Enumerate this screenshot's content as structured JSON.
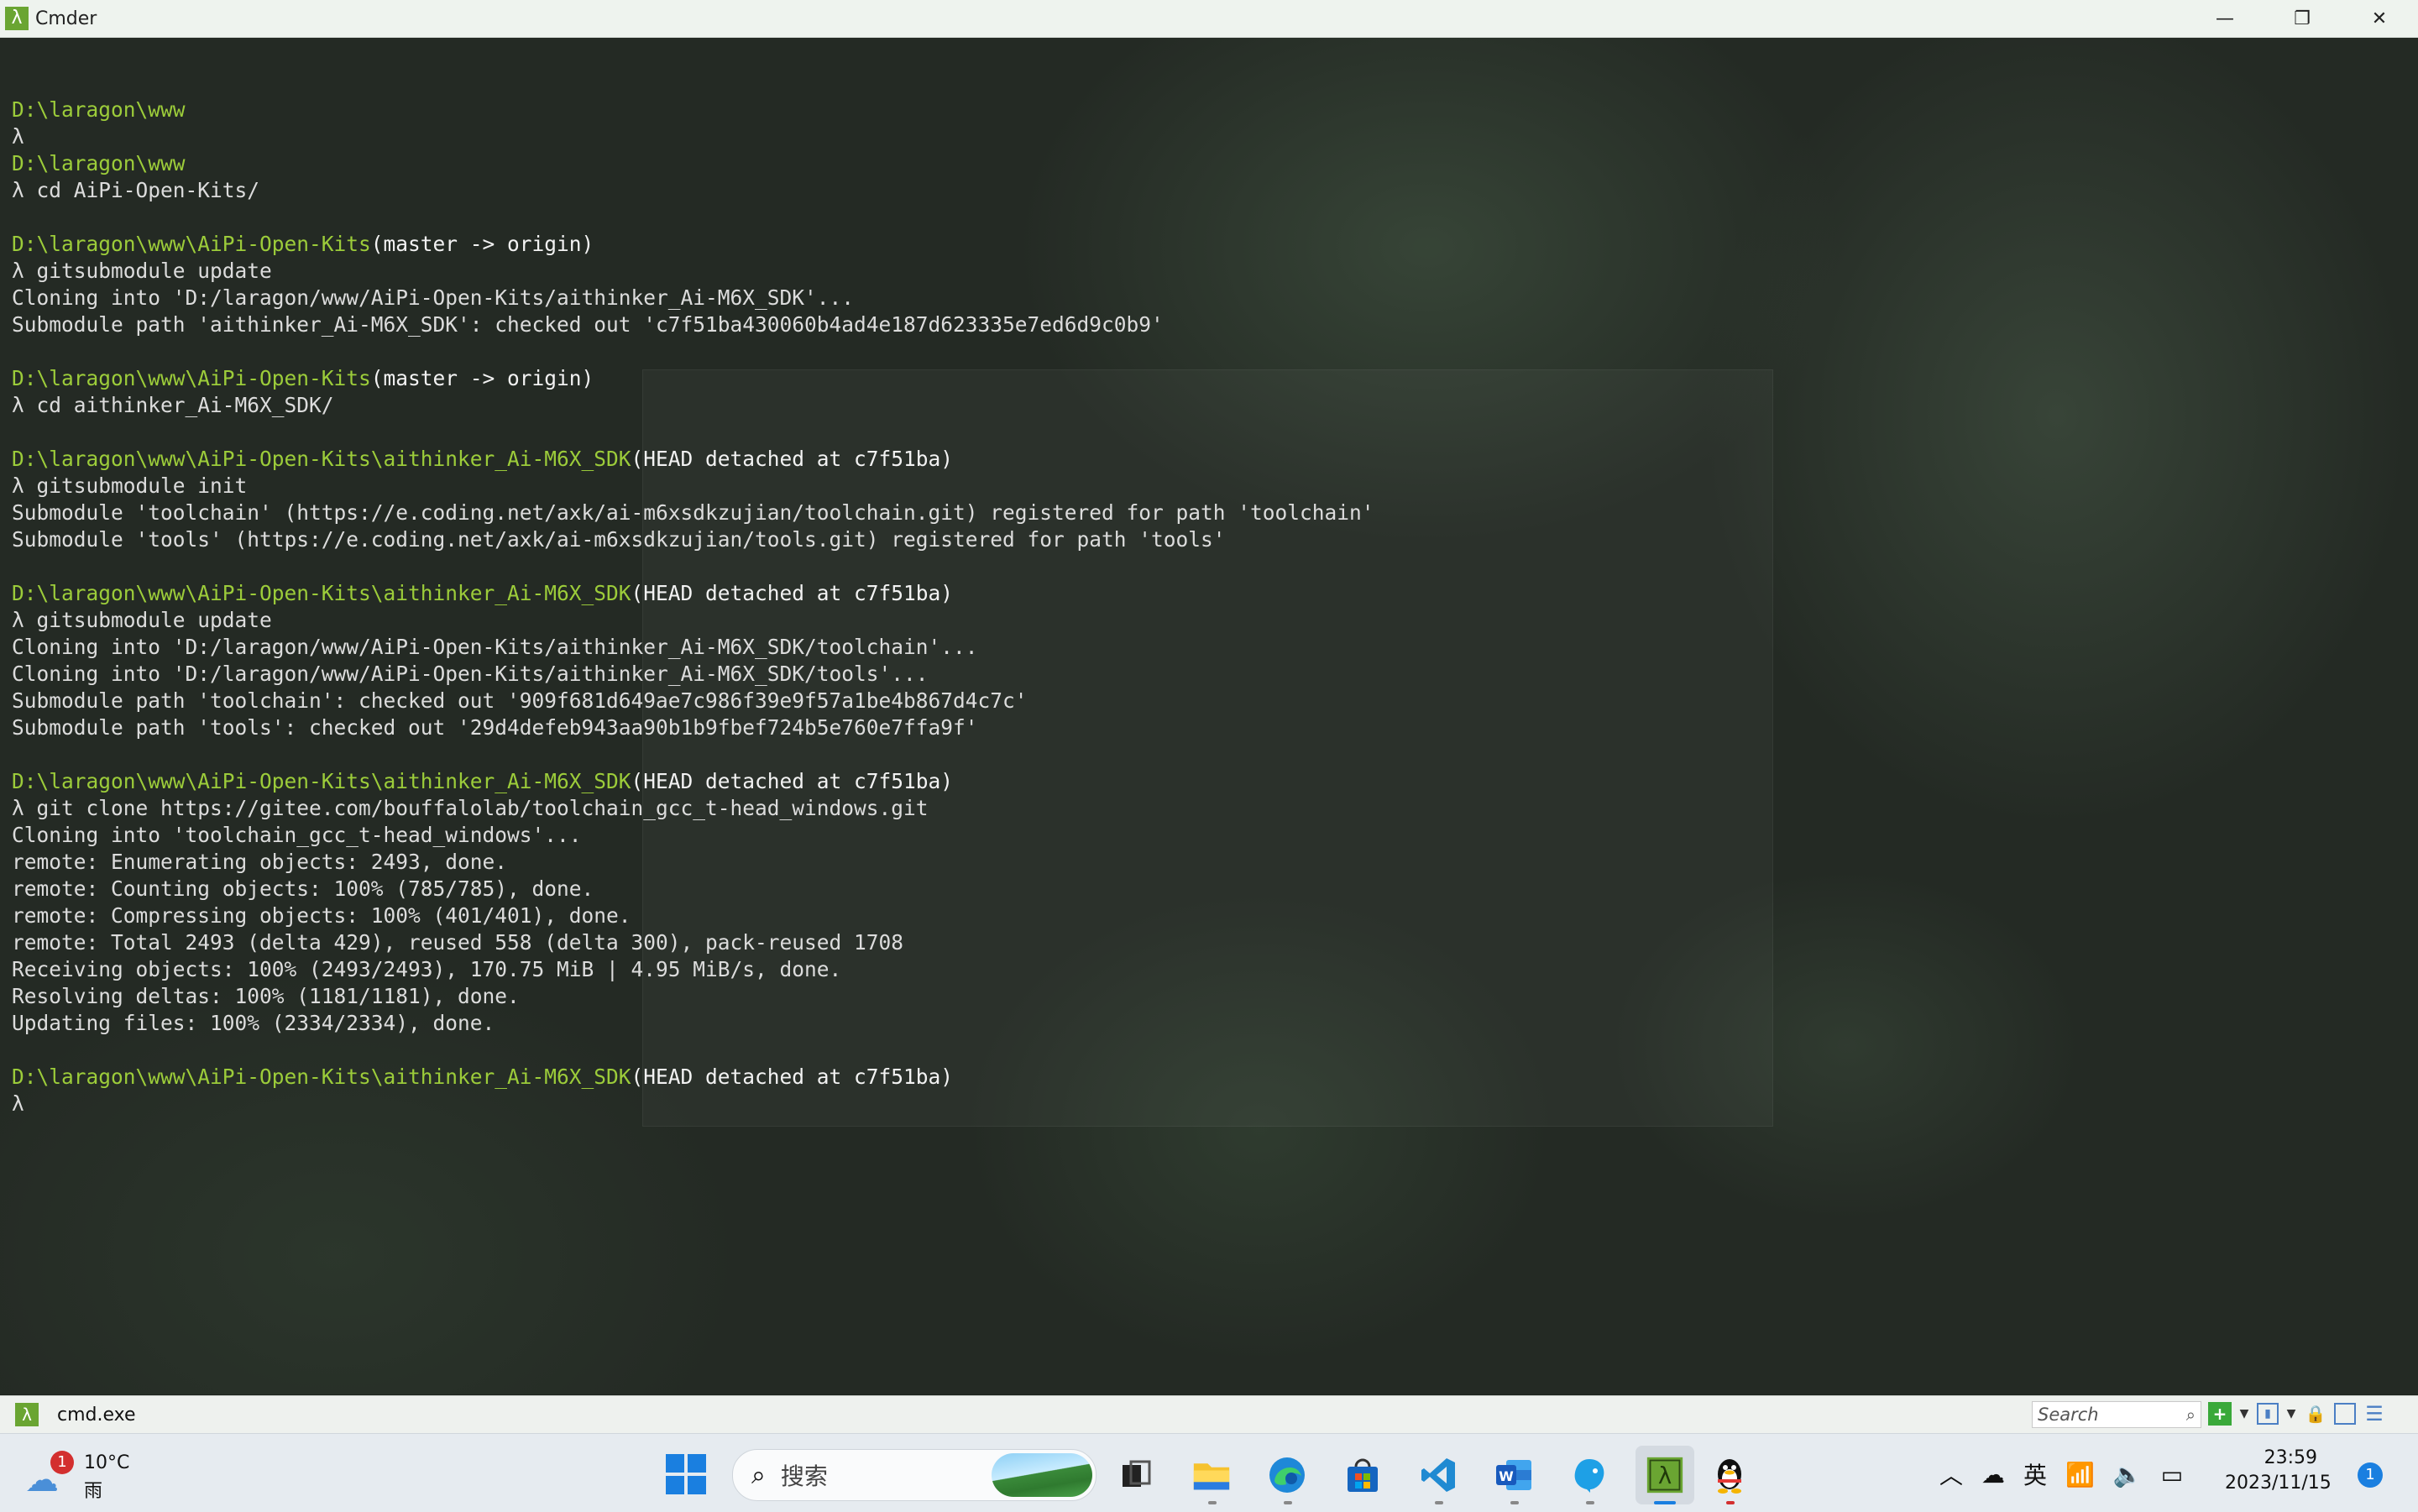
{
  "window": {
    "title": "Cmder",
    "app_icon_glyph": "λ",
    "controls": {
      "minimize": "—",
      "restore": "❐",
      "close": "✕"
    }
  },
  "console": {
    "lines": [
      {
        "kind": "blank"
      },
      {
        "kind": "prompt",
        "path": "D:\\laragon\\www",
        "branch": ""
      },
      {
        "kind": "cmd",
        "text": "λ"
      },
      {
        "kind": "prompt",
        "path": "D:\\laragon\\www",
        "branch": ""
      },
      {
        "kind": "cmd",
        "text": "λ cd AiPi-Open-Kits/"
      },
      {
        "kind": "blank"
      },
      {
        "kind": "prompt",
        "path": "D:\\laragon\\www\\AiPi-Open-Kits",
        "branch": "(master -> origin)"
      },
      {
        "kind": "cmd",
        "text": "λ gitsubmodule update"
      },
      {
        "kind": "out",
        "text": "Cloning into 'D:/laragon/www/AiPi-Open-Kits/aithinker_Ai-M6X_SDK'..."
      },
      {
        "kind": "out",
        "text": "Submodule path 'aithinker_Ai-M6X_SDK': checked out 'c7f51ba430060b4ad4e187d623335e7ed6d9c0b9'"
      },
      {
        "kind": "blank"
      },
      {
        "kind": "prompt",
        "path": "D:\\laragon\\www\\AiPi-Open-Kits",
        "branch": "(master -> origin)"
      },
      {
        "kind": "cmd",
        "text": "λ cd aithinker_Ai-M6X_SDK/"
      },
      {
        "kind": "blank"
      },
      {
        "kind": "prompt",
        "path": "D:\\laragon\\www\\AiPi-Open-Kits\\aithinker_Ai-M6X_SDK",
        "branch": "(HEAD detached at c7f51ba)"
      },
      {
        "kind": "cmd",
        "text": "λ gitsubmodule init"
      },
      {
        "kind": "out",
        "text": "Submodule 'toolchain' (https://e.coding.net/axk/ai-m6xsdkzujian/toolchain.git) registered for path 'toolchain'"
      },
      {
        "kind": "out",
        "text": "Submodule 'tools' (https://e.coding.net/axk/ai-m6xsdkzujian/tools.git) registered for path 'tools'"
      },
      {
        "kind": "blank"
      },
      {
        "kind": "prompt",
        "path": "D:\\laragon\\www\\AiPi-Open-Kits\\aithinker_Ai-M6X_SDK",
        "branch": "(HEAD detached at c7f51ba)"
      },
      {
        "kind": "cmd",
        "text": "λ gitsubmodule update"
      },
      {
        "kind": "out",
        "text": "Cloning into 'D:/laragon/www/AiPi-Open-Kits/aithinker_Ai-M6X_SDK/toolchain'..."
      },
      {
        "kind": "out",
        "text": "Cloning into 'D:/laragon/www/AiPi-Open-Kits/aithinker_Ai-M6X_SDK/tools'..."
      },
      {
        "kind": "out",
        "text": "Submodule path 'toolchain': checked out '909f681d649ae7c986f39e9f57a1be4b867d4c7c'"
      },
      {
        "kind": "out",
        "text": "Submodule path 'tools': checked out '29d4defeb943aa90b1b9fbef724b5e760e7ffa9f'"
      },
      {
        "kind": "blank"
      },
      {
        "kind": "prompt",
        "path": "D:\\laragon\\www\\AiPi-Open-Kits\\aithinker_Ai-M6X_SDK",
        "branch": "(HEAD detached at c7f51ba)"
      },
      {
        "kind": "cmd",
        "text": "λ git clone https://gitee.com/bouffalolab/toolchain_gcc_t-head_windows.git"
      },
      {
        "kind": "out",
        "text": "Cloning into 'toolchain_gcc_t-head_windows'..."
      },
      {
        "kind": "out",
        "text": "remote: Enumerating objects: 2493, done."
      },
      {
        "kind": "out",
        "text": "remote: Counting objects: 100% (785/785), done."
      },
      {
        "kind": "out",
        "text": "remote: Compressing objects: 100% (401/401), done."
      },
      {
        "kind": "out",
        "text": "remote: Total 2493 (delta 429), reused 558 (delta 300), pack-reused 1708"
      },
      {
        "kind": "out",
        "text": "Receiving objects: 100% (2493/2493), 170.75 MiB | 4.95 MiB/s, done."
      },
      {
        "kind": "out",
        "text": "Resolving deltas: 100% (1181/1181), done."
      },
      {
        "kind": "out",
        "text": "Updating files: 100% (2334/2334), done."
      },
      {
        "kind": "blank"
      },
      {
        "kind": "prompt",
        "path": "D:\\laragon\\www\\AiPi-Open-Kits\\aithinker_Ai-M6X_SDK",
        "branch": "(HEAD detached at c7f51ba)"
      },
      {
        "kind": "cmd",
        "text": "λ"
      }
    ]
  },
  "tabbar": {
    "tab_label": "cmd.exe",
    "search_placeholder": "Search",
    "icons": [
      "new-tab-icon",
      "dropdown-icon",
      "split-view-icon",
      "dropdown-icon",
      "lock-icon",
      "pane-icon",
      "menu-icon"
    ]
  },
  "taskbar": {
    "weather": {
      "temp": "10°C",
      "desc": "雨",
      "badge": "1"
    },
    "search_placeholder": "搜索",
    "apps": [
      "task-view",
      "file-explorer",
      "edge",
      "store",
      "vscode",
      "word",
      "app-blue",
      "cmder",
      "qq"
    ],
    "tray": {
      "ime": "英"
    },
    "time": "23:59",
    "date": "2023/11/15",
    "notifications": "1"
  },
  "colors": {
    "path": "#9ccc3a",
    "text": "#dcdcdc",
    "accent": "#1a7fe0",
    "cmder_green": "#6aa532"
  }
}
